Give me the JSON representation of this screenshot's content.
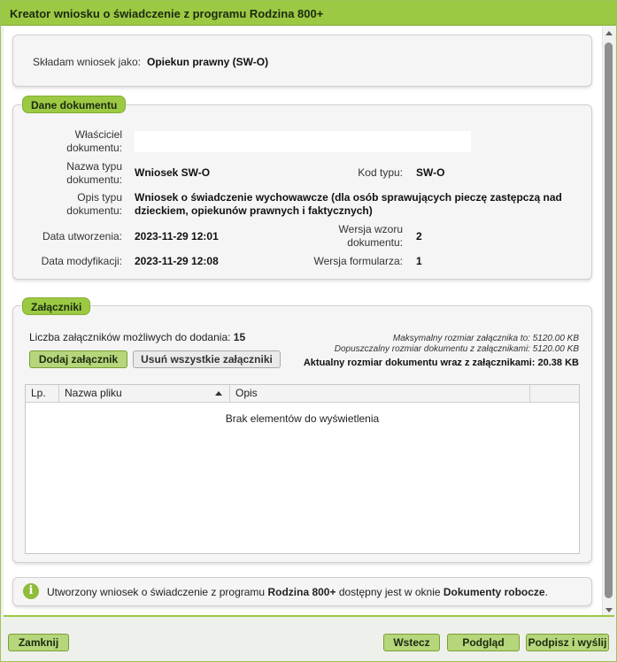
{
  "window": {
    "title": "Kreator wniosku o świadczenie z programu Rodzina 800+"
  },
  "applicant": {
    "label": "Składam wniosek jako:",
    "value": "Opiekun prawny (SW-O)"
  },
  "document_section": {
    "legend": "Dane dokumentu",
    "owner_label": "Właściciel dokumentu:",
    "owner_value": "",
    "type_name_label": "Nazwa typu dokumentu:",
    "type_name_value": "Wniosek SW-O",
    "type_code_label": "Kod typu:",
    "type_code_value": "SW-O",
    "type_desc_label": "Opis typu dokumentu:",
    "type_desc_value": "Wniosek o świadczenie wychowawcze (dla osób sprawujących pieczę zastępczą nad dzieckiem, opiekunów prawnych i faktycznych)",
    "created_label": "Data utworzenia:",
    "created_value": "2023-11-29 12:01",
    "template_version_label": "Wersja wzoru dokumentu:",
    "template_version_value": "2",
    "modified_label": "Data modyfikacji:",
    "modified_value": "2023-11-29 12:08",
    "form_version_label": "Wersja formularza:",
    "form_version_value": "1"
  },
  "attachments_section": {
    "legend": "Załączniki",
    "count_label": "Liczba załączników możliwych do dodania:",
    "count_value": "15",
    "max_size_text": "Maksymalny rozmiar załącznika to: 5120.00 KB",
    "allowed_size_text": "Dopuszczalny rozmiar dokumentu z załącznikami: 5120.00 KB",
    "current_size_text": "Aktualny rozmiar dokumentu wraz z załącznikami: 20.38 KB",
    "add_button": "Dodaj załącznik",
    "remove_all_button": "Usuń wszystkie załączniki",
    "columns": [
      "Lp.",
      "Nazwa pliku",
      "Opis"
    ],
    "empty_text": "Brak elementów do wyświetlenia"
  },
  "info": {
    "icon_glyph": "i",
    "text_before": "Utworzony wniosek o świadczenie z programu ",
    "program_name": "Rodzina 800+",
    "text_middle": " dostępny jest w oknie ",
    "window_name": "Dokumenty robocze",
    "text_end": "."
  },
  "footer": {
    "close_button": "Zamknij",
    "back_button": "Wstecz",
    "preview_button": "Podgląd",
    "sign_send_button": "Podpisz i wyślij"
  },
  "colors": {
    "accent_green": "#9cc943",
    "button_green": "#b5d67b",
    "panel_bg": "#f5f5f5"
  }
}
